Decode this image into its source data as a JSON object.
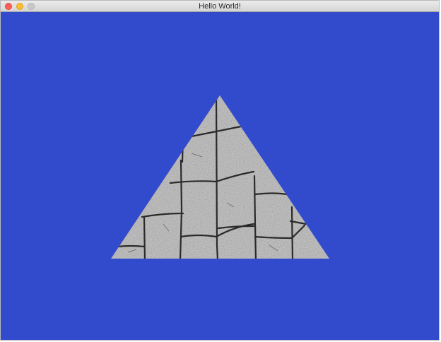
{
  "window": {
    "title": "Hello World!"
  },
  "colors": {
    "clear_color": "#324bcc",
    "texture_base": "#b8b8b8",
    "mortar": "#2f2f2f"
  },
  "scene": {
    "object": "textured-triangle",
    "texture": "stone-pavement"
  }
}
